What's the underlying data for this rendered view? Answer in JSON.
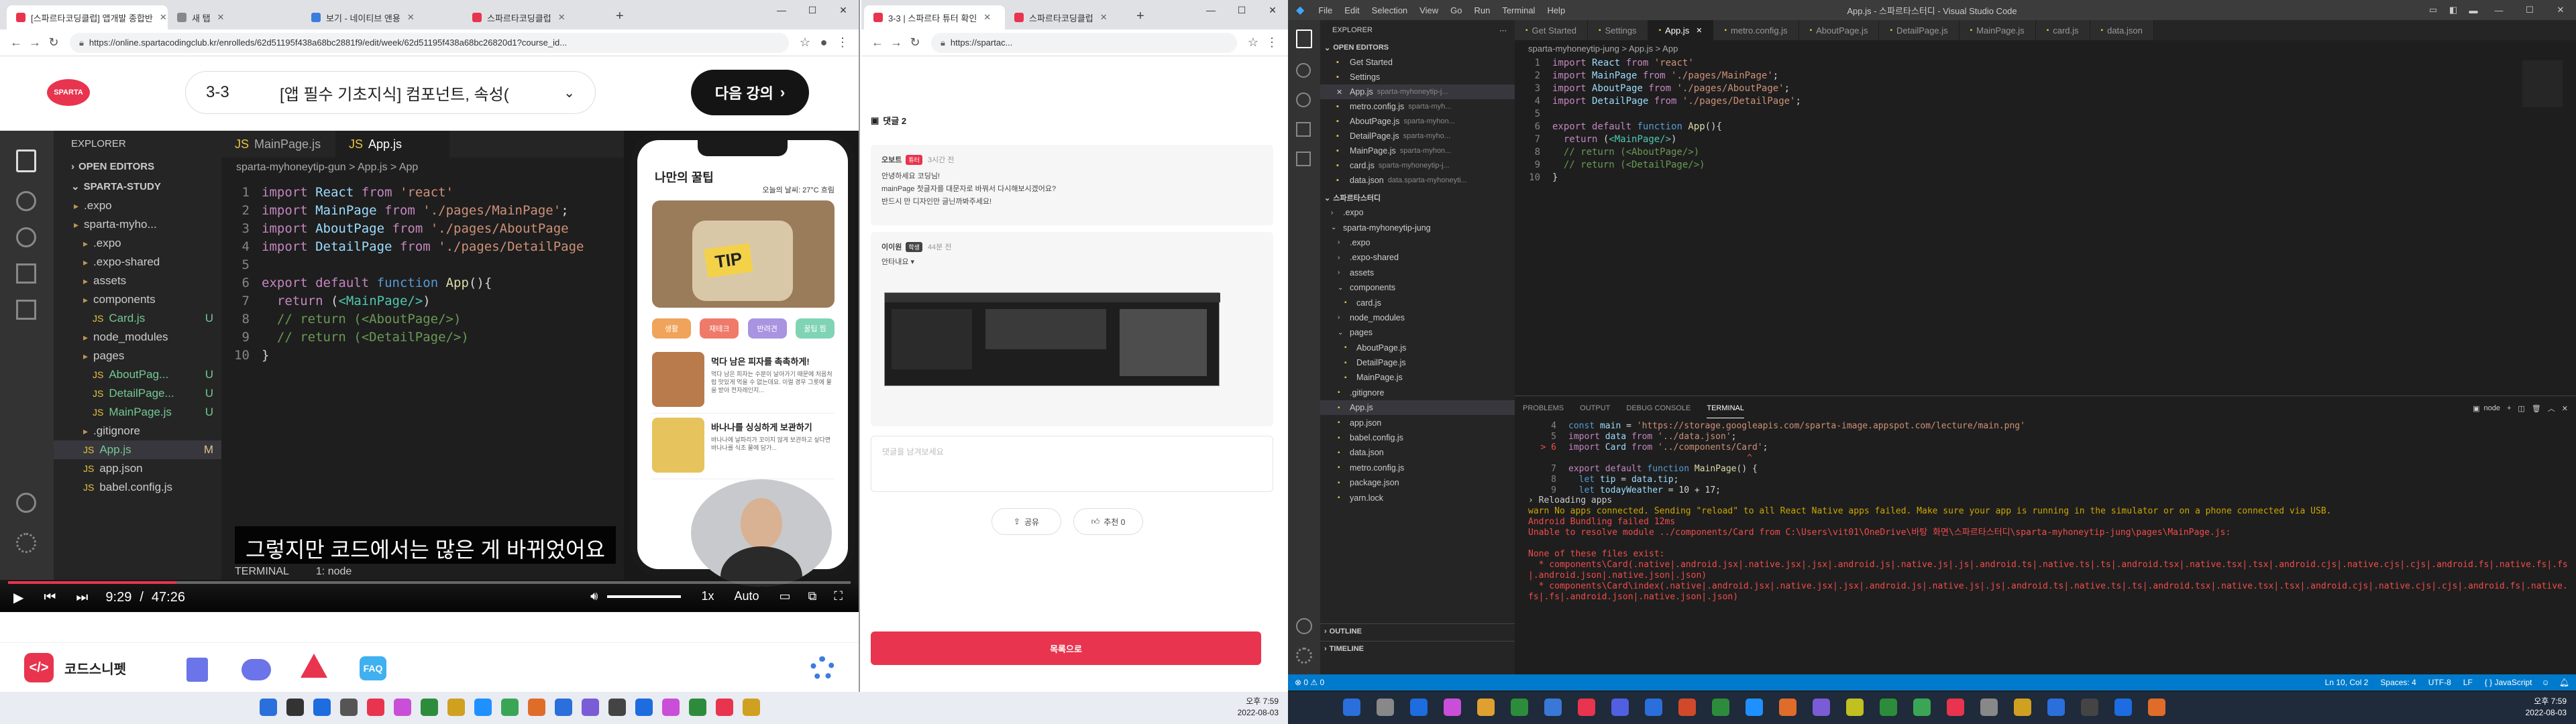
{
  "left_browser": {
    "tabs": [
      "[스파르타코딩클럽] 앱개발 종합반",
      "새 탭",
      "보기 - 네이티브 앤용",
      "스파르타코딩클럽"
    ],
    "url": "https://online.spartacodingclub.kr/enrolleds/62d51195f438a68bc2881f9/edit/week/62d51195f438a68bc26820d1?course_id...",
    "lecture_no": "3-3",
    "lecture_title": "[앱 필수 기초지식] 컴포넌트, 속성(",
    "next_button": "다음 강의",
    "logo": "SPARTA"
  },
  "video": {
    "explorer_title": "EXPLORER",
    "open_editors": "OPEN EDITORS",
    "project": "SPARTA-STUDY",
    "tree": [
      {
        "label": ".expo",
        "mod": ""
      },
      {
        "label": "sparta-myho...",
        "mod": ""
      },
      {
        "label": ".expo",
        "mod": ""
      },
      {
        "label": ".expo-shared",
        "mod": ""
      },
      {
        "label": "assets",
        "mod": ""
      },
      {
        "label": "components",
        "mod": ""
      },
      {
        "label": "Card.js",
        "mod": "U"
      },
      {
        "label": "node_modules",
        "mod": ""
      },
      {
        "label": "pages",
        "mod": ""
      },
      {
        "label": "AboutPag...",
        "mod": "U"
      },
      {
        "label": "DetailPage...",
        "mod": "U"
      },
      {
        "label": "MainPage.js",
        "mod": "U"
      },
      {
        "label": ".gitignore",
        "mod": ""
      },
      {
        "label": "App.js",
        "mod": "M"
      },
      {
        "label": "app.json",
        "mod": ""
      },
      {
        "label": "babel.config.js",
        "mod": ""
      }
    ],
    "tabs": [
      "MainPage.js",
      "App.js"
    ],
    "breadcrumb": "sparta-myhoneytip-gun  >  App.js  >  App",
    "code": [
      "import React from 'react'",
      "import MainPage from './pages/MainPage';",
      "import AboutPage from './pages/AboutPage",
      "import DetailPage from './pages/DetailPage",
      "",
      "export default function App(){",
      "  return (<MainPage/>)",
      "  // return (<AboutPage/>)",
      "  // return (<DetailPage/>)",
      "}"
    ],
    "phone_app_title": "나만의 꿀팁",
    "phone_weather": "오늘의 날씨: 27°C 흐림",
    "phone_tip_text": "TIP",
    "phone_categories": [
      "생활",
      "재테크",
      "반려견",
      "꿀팁 찜"
    ],
    "phone_cards": [
      {
        "title": "먹다 남은 피자를 촉촉하게!",
        "desc": "먹다 남은 피자는 수분이 날아가기 때문에 처음처럼 맛있게 먹을 수 없는데요. 이럴 경우 그릇에 물을 받아 전자레인지..."
      },
      {
        "title": "바나나를 싱싱하게 보관하기",
        "desc": "바나나에 날파리가 꼬이지 않게 보관하고 싶다면 바나나를 식초 물에 담가..."
      }
    ],
    "subtitle": "그렇지만 코드에서는 많은 게 바뀌었어요",
    "time_current": "9:29",
    "time_sep": "/",
    "time_total": "47:26",
    "speed": "1x",
    "quality": "Auto",
    "terminal_label": "TERMINAL",
    "terminal_node": "1: node",
    "progress": 0.2
  },
  "bottom_bar": {
    "brand": "코드스니펫",
    "faq": "FAQ"
  },
  "right_browser": {
    "tabs": [
      "3-3 | 스파르타 튜터 확인",
      "스파르타코딩클럽"
    ],
    "url": "https://spartac...",
    "comment_header": "댓글 2",
    "comments": [
      {
        "author": "오보트",
        "badge": "튜터",
        "time": "3시간 전",
        "lines": [
          "안녕하세요 코딩님!",
          "mainPage 첫글자를 대문자로 바꿔서 다시해보시겠어요?",
          "반드시 만 디자인만 글닌까봐주세요!"
        ]
      },
      {
        "author": "이이원",
        "badge": "학생",
        "time": "44분 전",
        "lines": [
          "안타내요 ▾"
        ]
      }
    ],
    "input_placeholder": "댓글을 남겨보세요",
    "share": "공유",
    "like": "추천 0",
    "submit": "목록으로"
  },
  "vscode": {
    "window_title": "App.js - 스파르타스터디 - Visual Studio Code",
    "menu": [
      "File",
      "Edit",
      "Selection",
      "View",
      "Go",
      "Run",
      "Terminal",
      "Help"
    ],
    "tabs": [
      "Get Started",
      "Settings",
      "App.js",
      "metro.config.js",
      "AboutPage.js",
      "DetailPage.js",
      "MainPage.js",
      "card.js",
      "data.json"
    ],
    "active_tab": "App.js",
    "breadcrumb": "sparta-myhoneytip-jung  >  App.js  >  App",
    "explorer_title": "EXPLORER",
    "open_editors_header": "OPEN EDITORS",
    "open_editors": [
      {
        "name": "Get Started",
        "path": ""
      },
      {
        "name": "Settings",
        "path": ""
      },
      {
        "name": "App.js",
        "path": "sparta-myhoneytip-j..."
      },
      {
        "name": "metro.config.js",
        "path": "sparta-myh..."
      },
      {
        "name": "AboutPage.js",
        "path": "sparta-myhon..."
      },
      {
        "name": "DetailPage.js",
        "path": "sparta-myho..."
      },
      {
        "name": "MainPage.js",
        "path": "sparta-myhon..."
      },
      {
        "name": "card.js",
        "path": "sparta-myhoneytip-j..."
      },
      {
        "name": "data.json",
        "path": "data.sparta-myhoneyti..."
      }
    ],
    "workspace_header": "스파르타스터디",
    "tree": [
      ".expo",
      "sparta-myhoneytip-jung",
      ".expo",
      ".expo-shared",
      "assets",
      "components",
      "card.js",
      "node_modules",
      "pages",
      "AboutPage.js",
      "DetailPage.js",
      "MainPage.js",
      ".gitignore",
      "App.js",
      "app.json",
      "babel.config.js",
      "data.json",
      "metro.config.js",
      "package.json",
      "yarn.lock"
    ],
    "outline": "OUTLINE",
    "timeline": "TIMELINE",
    "code": [
      "import React from 'react'",
      "import MainPage from './pages/MainPage';",
      "import AboutPage from './pages/AboutPage';",
      "import DetailPage from './pages/DetailPage';",
      "",
      "export default function App(){",
      "  return (<MainPage/>)",
      "  // return (<AboutPage/>)",
      "  // return (<DetailPage/>)",
      "}"
    ],
    "panel_tabs": [
      "PROBLEMS",
      "OUTPUT",
      "DEBUG CONSOLE",
      "TERMINAL"
    ],
    "terminal_select": "node",
    "terminal_code": [
      {
        "n": "4",
        "text": "const main = 'https://storage.googleapis.com/sparta-image.appspot.com/lecture/main.png'"
      },
      {
        "n": "5",
        "text": "import data from '../data.json';"
      },
      {
        "n": "6",
        "text": "import Card from '../components/Card';"
      },
      {
        "n": "",
        "text": "                                  ^"
      },
      {
        "n": "7",
        "text": "export default function MainPage() {"
      },
      {
        "n": "8",
        "text": "  let tip = data.tip;"
      },
      {
        "n": "9",
        "text": "  let todayWeather = 10 + 17;"
      }
    ],
    "terminal_log": [
      "› Reloading apps",
      "warn No apps connected. Sending \"reload\" to all React Native apps failed. Make sure your app is running in the simulator or on a phone connected via USB.",
      "Android Bundling failed 12ms",
      "Unable to resolve module ../components/Card from C:\\Users\\vit01\\OneDrive\\바탕 화면\\스파르타스터디\\sparta-myhoneytip-jung\\pages\\MainPage.js:",
      "",
      "None of these files exist:",
      "  * components\\Card(.native|.android.jsx|.native.jsx|.jsx|.android.js|.native.js|.js|.android.ts|.native.ts|.ts|.android.tsx|.native.tsx|.tsx|.android.cjs|.native.cjs|.cjs|.android.fs|.native.fs|.fs|.android.json|.native.json|.json)",
      "  * components\\Card\\index(.native|.android.jsx|.native.jsx|.jsx|.android.js|.native.js|.js|.android.ts|.native.ts|.ts|.android.tsx|.native.tsx|.tsx|.android.cjs|.native.cjs|.cjs|.android.fs|.native.fs|.fs|.android.json|.native.json|.json)"
    ],
    "status_left": "⊗ 0  ⚠ 0",
    "status_right": [
      "Ln 10, Col 2",
      "Spaces: 4",
      "UTF-8",
      "LF",
      "{ } JavaScript"
    ]
  },
  "taskbar": {
    "time": "오후 7:59",
    "date": "2022-08-03"
  },
  "colors": {
    "accent": "#e8344e",
    "vscode_blue": "#007acc",
    "vscode_bg": "#1e1e1e"
  }
}
